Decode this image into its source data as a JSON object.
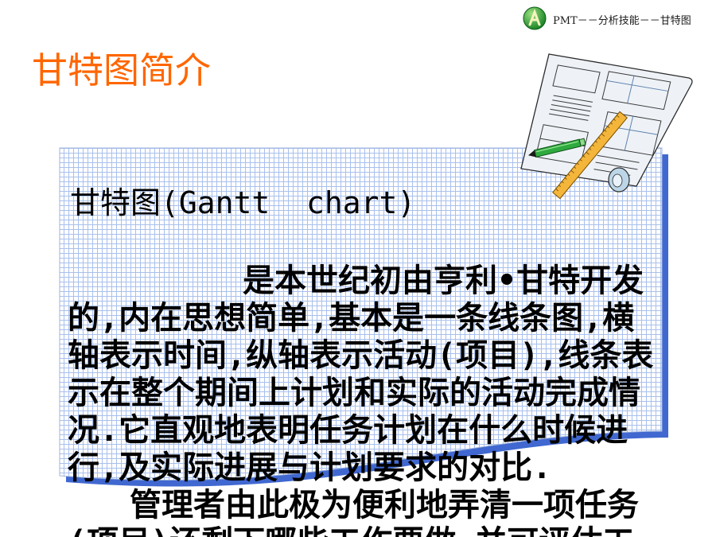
{
  "header": {
    "logo_icon": "green-circle-logo-icon",
    "breadcrumb": "PMT－－分析技能－－甘特图"
  },
  "slide": {
    "title": "甘特图简介",
    "clipart_icon": "blueprint-ruler-pen-clipart",
    "box_heading": "甘特图(Gantt  chart)",
    "paragraph1_lines": [
      "是本世纪初由亨利•甘特开发",
      "的,内在思想简单,基本是一条线条图,横",
      "轴表示时间,纵轴表示活动(项目),线条表",
      "示在整个期间上计划和实际的活动完成情",
      "况.它直观地表明任务计划在什么时候进",
      "行,及实际进展与计划要求的对比."
    ],
    "paragraph2_lines": [
      "管理者由此极为便利地弄清一项任务",
      "(项目)还剩下哪些工作要做,并可评估工"
    ]
  },
  "colors": {
    "title": "#FF6600",
    "grid_line": "#A9C0EC",
    "box_shadow": "#4068D0",
    "box_border": "#9FB3DC",
    "text": "#000000"
  }
}
